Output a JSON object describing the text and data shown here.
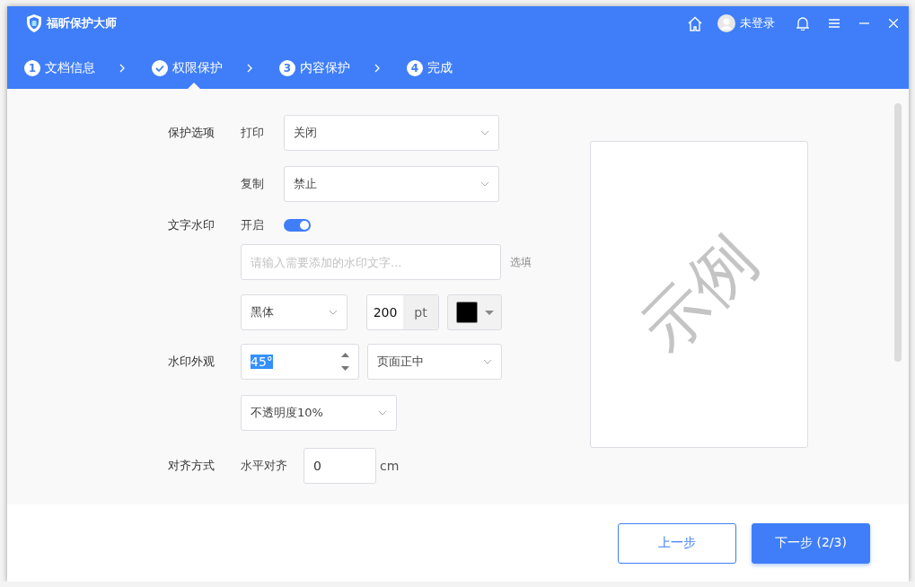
{
  "window": {
    "title": "福昕保护大师"
  },
  "header": {
    "user": "未登录"
  },
  "steps": [
    {
      "number": "1",
      "label": "文档信息",
      "selected": false,
      "completed": false
    },
    {
      "label": "权限保护",
      "selected": true,
      "completed": true
    },
    {
      "number": "3",
      "label": "内容保护",
      "selected": false,
      "completed": false
    },
    {
      "number": "4",
      "label": "完成",
      "selected": false,
      "completed": false
    }
  ],
  "protection": {
    "label": "保护选项",
    "options": [
      {
        "label": "打印",
        "value": "关闭"
      },
      {
        "label": "复制",
        "value": "禁止"
      }
    ]
  },
  "text_watermark": {
    "label": "文字水印",
    "toggle_label": "开启",
    "on": true,
    "placeholder": "请输入需要添加的水印文字...",
    "optional_note": "选填",
    "font": "黑体",
    "size": "200",
    "size_unit": "pt",
    "color": "#000000"
  },
  "appearance": {
    "label": "水印外观",
    "rotation": "45°",
    "rotation_selected": true,
    "position": "页面正中",
    "opacity": "不透明度10%"
  },
  "alignment": {
    "label": "对齐方式",
    "horizontal_label": "水平对齐",
    "horizontal": "0",
    "unit": "cm"
  },
  "preview": {
    "watermark": "示例"
  },
  "buttons": [
    {
      "label": "上一步",
      "kind": "secondary"
    },
    {
      "label": "下一步 (2/3)",
      "kind": "primary"
    }
  ]
}
